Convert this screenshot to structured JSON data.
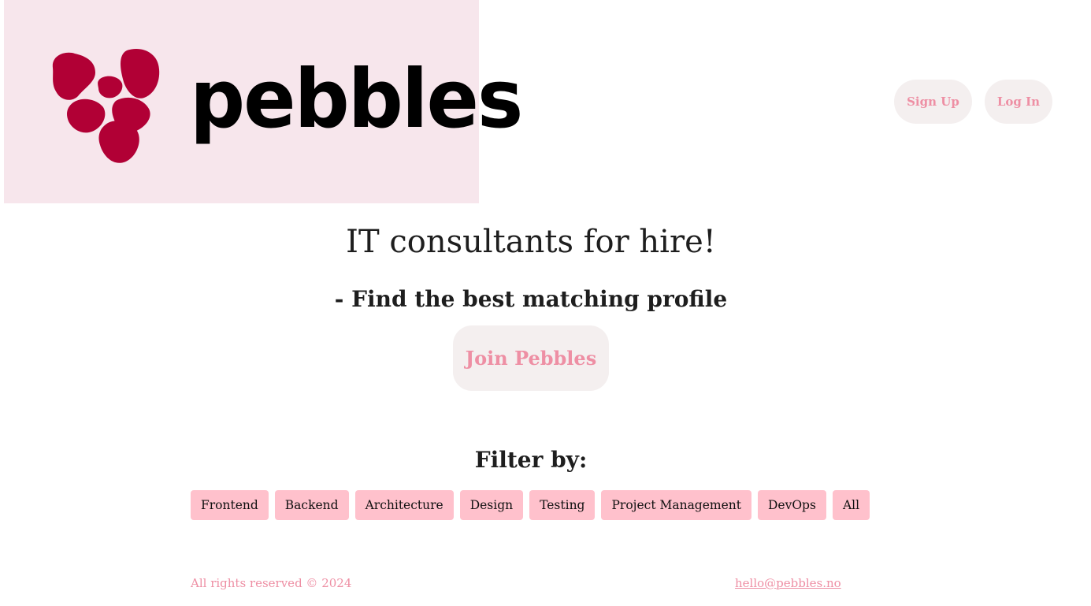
{
  "brand": {
    "logo_text": "pebbles",
    "logo_icon": "pebbles-heart-icon",
    "logo_bg": "#f7e6ec",
    "heart_color": "#b10035"
  },
  "nav": {
    "signup_label": "Sign Up",
    "login_label": "Log In"
  },
  "hero": {
    "title": "IT consultants for hire!",
    "subtitle": "- Find the best matching profile",
    "cta_label": "Join Pebbles"
  },
  "filters": {
    "title": "Filter by:",
    "items": [
      {
        "label": "Frontend"
      },
      {
        "label": "Backend"
      },
      {
        "label": "Architecture"
      },
      {
        "label": "Design"
      },
      {
        "label": "Testing"
      },
      {
        "label": "Project Management"
      },
      {
        "label": "DevOps"
      },
      {
        "label": "All"
      }
    ]
  },
  "footer": {
    "copyright": "All rights reserved © 2024",
    "email": "hello@pebbles.no"
  },
  "colors": {
    "accent": "#ee8fa4",
    "button_bg": "#f4efef",
    "filter_bg": "#ffc1cc"
  }
}
